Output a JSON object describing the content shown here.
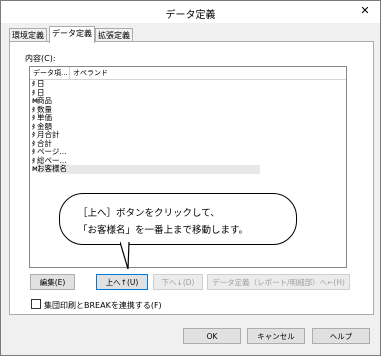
{
  "window": {
    "title": "データ定義",
    "close_glyph": "✕"
  },
  "tabs": [
    {
      "label": "環境定義"
    },
    {
      "label": "データ定義"
    },
    {
      "label": "拡張定義"
    }
  ],
  "content_label": "内容(C):",
  "list": {
    "columns": [
      "データ項...",
      "オペランド"
    ],
    "rows": [
      {
        "icon": "ﾀ",
        "label": "日"
      },
      {
        "icon": "ﾀ",
        "label": "日"
      },
      {
        "icon": "M",
        "label": "商品"
      },
      {
        "icon": "ﾀ",
        "label": "数量"
      },
      {
        "icon": "ﾀ",
        "label": "単価"
      },
      {
        "icon": "ﾀ",
        "label": "金額"
      },
      {
        "icon": "ﾀ",
        "label": "月合計"
      },
      {
        "icon": "ﾀ",
        "label": "合計"
      },
      {
        "icon": "ﾀ",
        "label": "ページ..."
      },
      {
        "icon": "ﾀ",
        "label": "総ペー..."
      },
      {
        "icon": "M",
        "label": "お客様名"
      }
    ]
  },
  "callout": {
    "line1": "［上へ］ボタンをクリックして、",
    "line2": "「お客様名」を一番上まで移動します。"
  },
  "buttons": {
    "edit": "編集(E)",
    "up": "上へ↑(U)",
    "down": "下へ↓(D)",
    "data_def": "データ定義（レポート/明細部）へ←(H)",
    "ok": "OK",
    "cancel": "キャンセル",
    "help": "ヘルプ"
  },
  "checkbox": {
    "label": "集団印刷とBREAKを連携する(F)",
    "checked": false
  }
}
